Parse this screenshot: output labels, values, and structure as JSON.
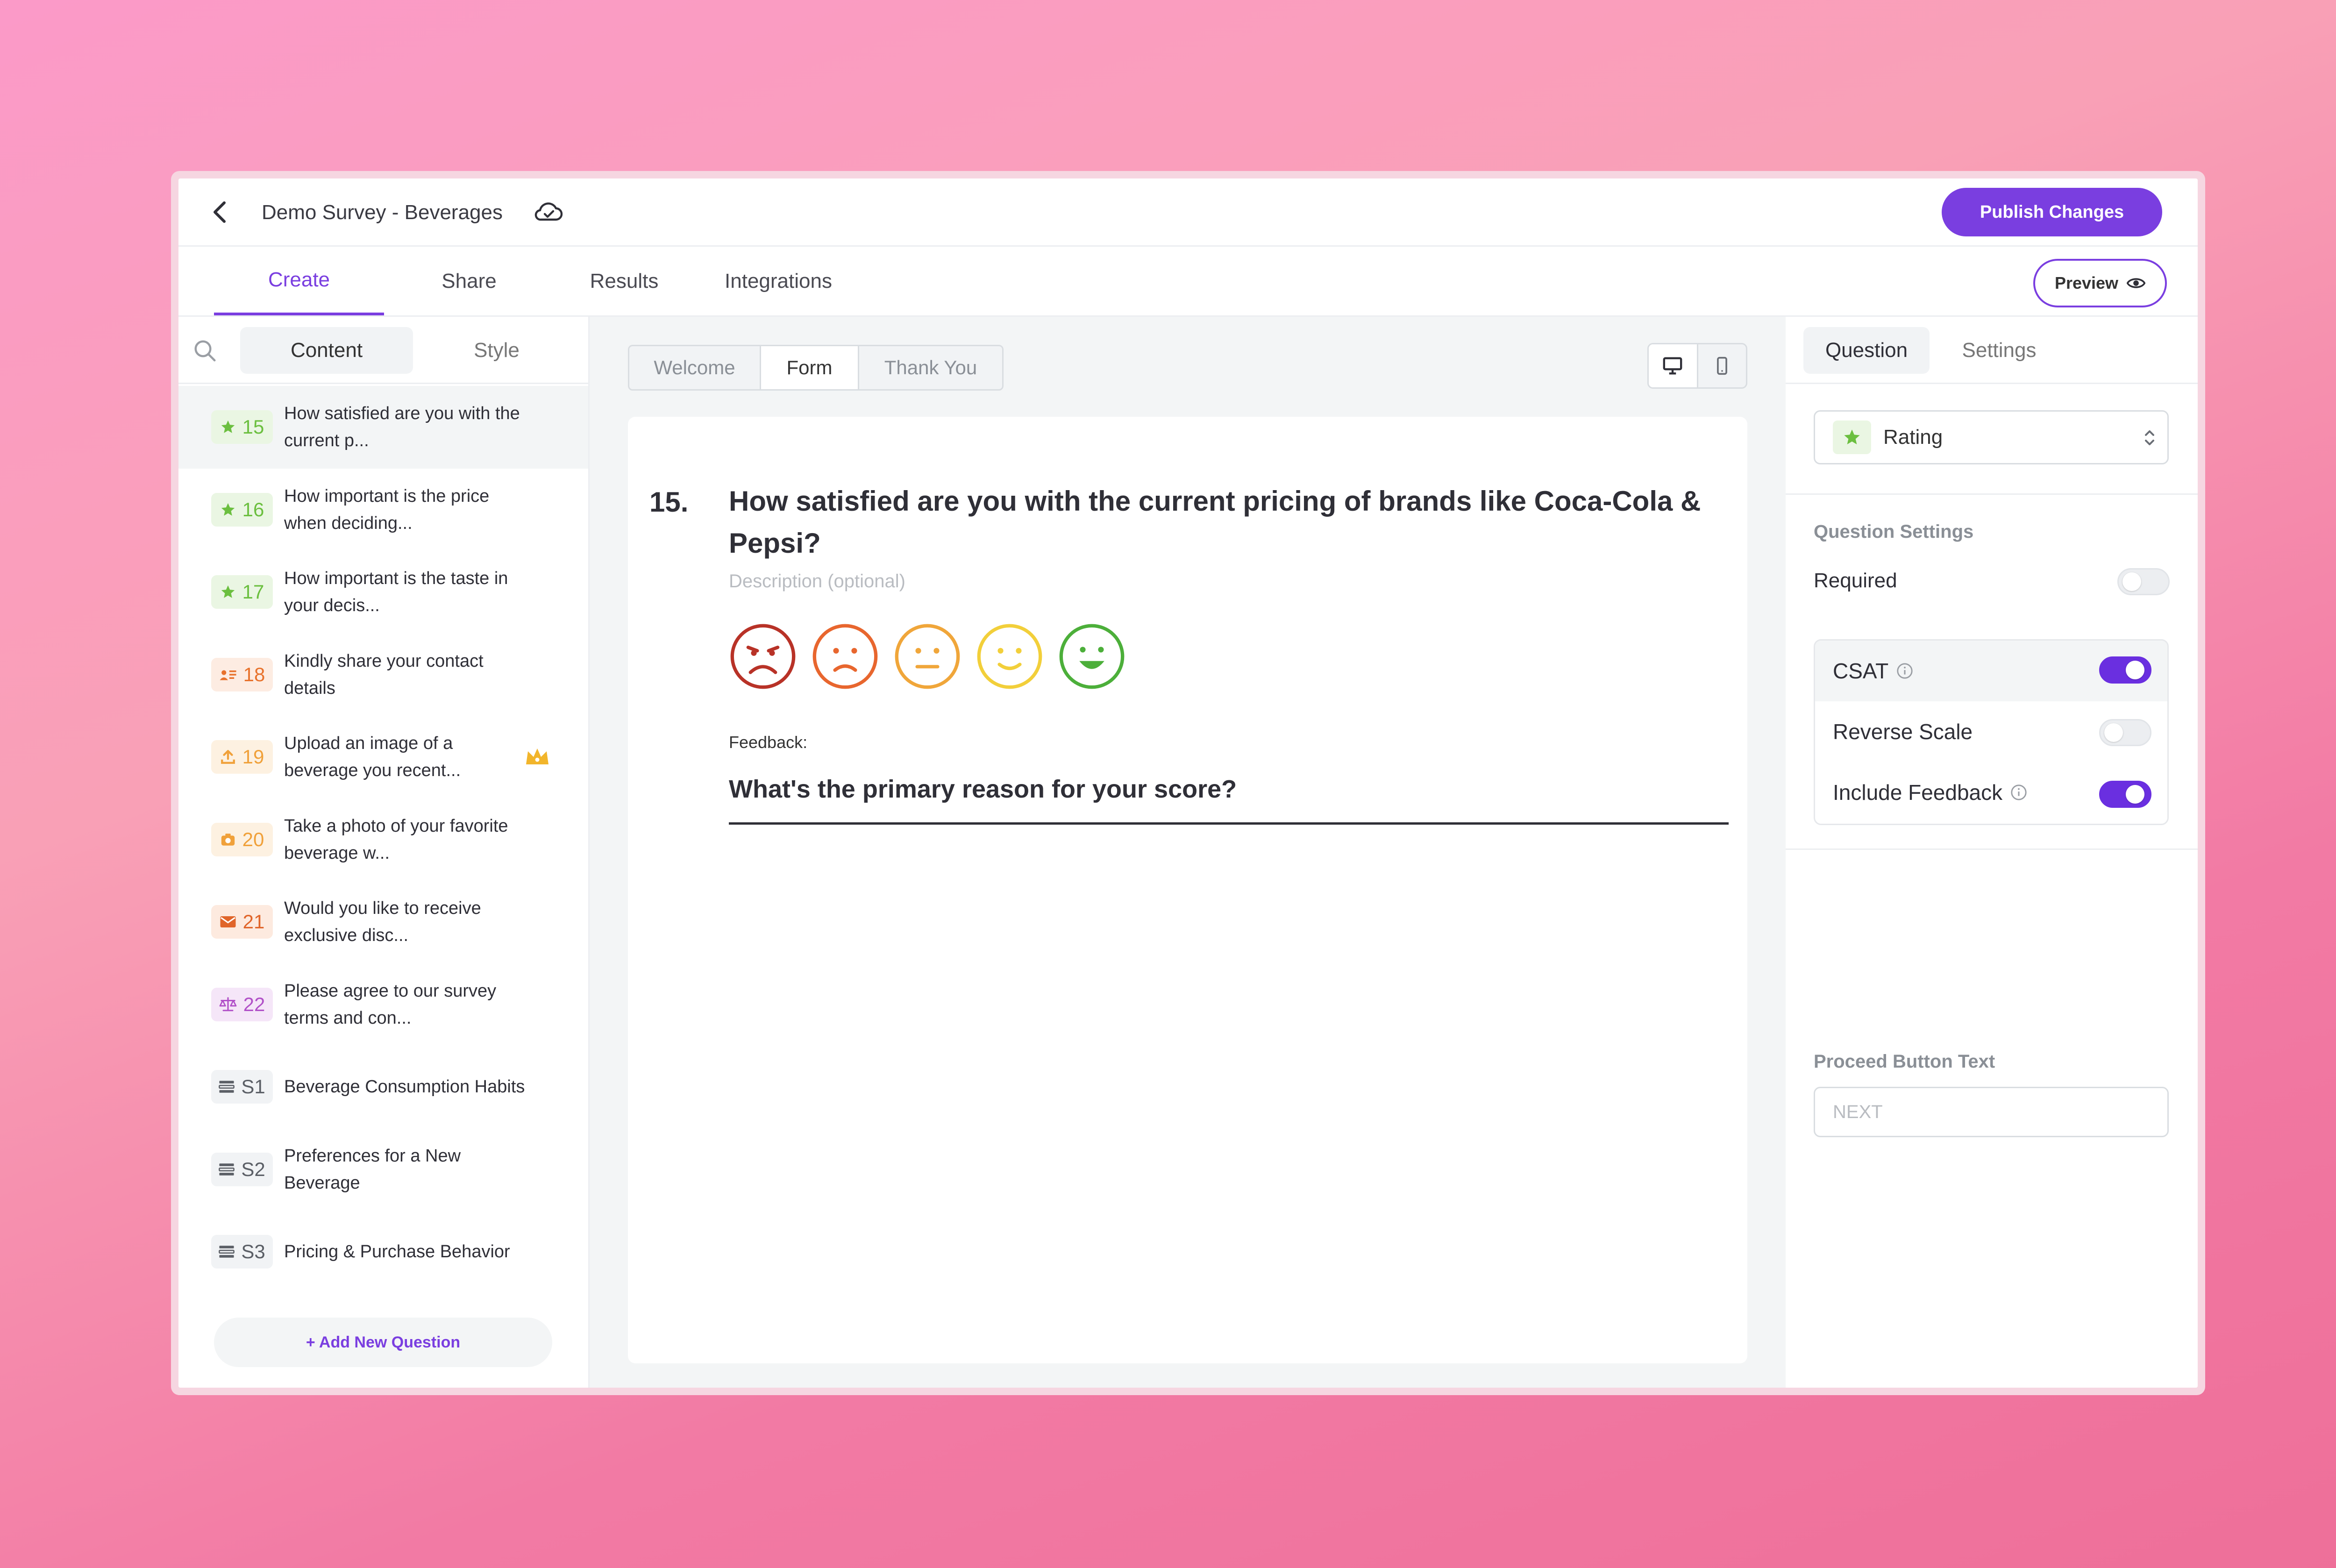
{
  "header": {
    "survey_title": "Demo Survey - Beverages",
    "publish_label": "Publish Changes",
    "preview_label": "Preview"
  },
  "tabs": [
    "Create",
    "Share",
    "Results",
    "Integrations"
  ],
  "sidebar": {
    "tabs": [
      "Content",
      "Style"
    ],
    "items": [
      {
        "num": "15",
        "text": "How satisfied are you with the current p...",
        "icon": "star-icon",
        "color": "#6bbf3f",
        "bg": "#eaf6e3"
      },
      {
        "num": "16",
        "text": "How important is the price when deciding...",
        "icon": "star-icon",
        "color": "#6bbf3f",
        "bg": "#eaf6e3"
      },
      {
        "num": "17",
        "text": "How important is the taste in your decis...",
        "icon": "star-icon",
        "color": "#6bbf3f",
        "bg": "#eaf6e3"
      },
      {
        "num": "18",
        "text": "Kindly share your contact details",
        "icon": "contact-card-icon",
        "color": "#e8722c",
        "bg": "#fdece2"
      },
      {
        "num": "19",
        "text": "Upload an image of a beverage you recent...",
        "icon": "upload-icon",
        "color": "#f0a13a",
        "bg": "#fdf1e1"
      },
      {
        "num": "20",
        "text": "Take a photo of your favorite beverage w...",
        "icon": "camera-icon",
        "color": "#f0a13a",
        "bg": "#fdf1e1"
      },
      {
        "num": "21",
        "text": "Would you like to receive exclusive disc...",
        "icon": "envelope-icon",
        "color": "#e0652a",
        "bg": "#fdeadf"
      },
      {
        "num": "22",
        "text": "Please agree to our survey terms and con...",
        "icon": "scale-icon",
        "color": "#b150c8",
        "bg": "#f5e6f8"
      },
      {
        "num": "S1",
        "text": "Beverage Consumption Habits",
        "icon": "section-icon",
        "color": "#5b5f66",
        "bg": "#f1f3f5"
      },
      {
        "num": "S2",
        "text": "Preferences for a New Beverage",
        "icon": "section-icon",
        "color": "#5b5f66",
        "bg": "#f1f3f5"
      },
      {
        "num": "S3",
        "text": "Pricing & Purchase Behavior",
        "icon": "section-icon",
        "color": "#5b5f66",
        "bg": "#f1f3f5"
      }
    ],
    "add_label": "+ Add New Question"
  },
  "center": {
    "segments": [
      "Welcome",
      "Form",
      "Thank You"
    ],
    "question_number": "15.",
    "question_title": "How satisfied are you with the current pricing of brands like Coca-Cola & Pepsi?",
    "description_placeholder": "Description (optional)",
    "feedback_label": "Feedback:",
    "feedback_question": "What's the primary reason for your score?",
    "faces": [
      {
        "name": "very-unhappy-face-icon",
        "color": "#c0392b"
      },
      {
        "name": "unhappy-face-icon",
        "color": "#e8662e"
      },
      {
        "name": "neutral-face-icon",
        "color": "#f0a63a"
      },
      {
        "name": "happy-face-icon",
        "color": "#f2cf3a"
      },
      {
        "name": "very-happy-face-icon",
        "color": "#4caf3a"
      }
    ]
  },
  "right_panel": {
    "tabs": [
      "Question",
      "Settings"
    ],
    "type_label": "Rating",
    "section_label": "Question Settings",
    "required_label": "Required",
    "options": [
      {
        "label": "CSAT",
        "on": true,
        "info": true
      },
      {
        "label": "Reverse Scale",
        "on": false,
        "info": false
      },
      {
        "label": "Include Feedback",
        "on": true,
        "info": true
      }
    ],
    "proceed_label": "Proceed Button Text",
    "proceed_placeholder": "NEXT"
  },
  "colors": {
    "accent": "#7a3ee0"
  }
}
